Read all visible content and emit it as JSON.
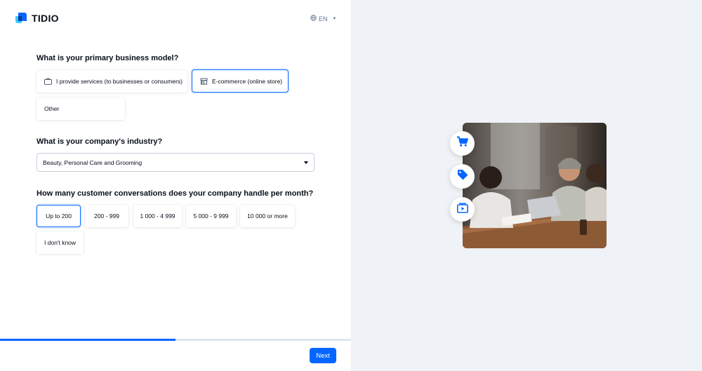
{
  "brand": {
    "name": "TIDIO",
    "logo_color": "#0566ff"
  },
  "language": {
    "icon": "globe-icon",
    "label": "EN"
  },
  "q1": {
    "title": "What is your primary business model?",
    "options": [
      {
        "label": "I provide services (to businesses or consumers)",
        "icon": "briefcase-icon",
        "selected": false
      },
      {
        "label": "E-commerce (online store)",
        "icon": "store-icon",
        "selected": true
      },
      {
        "label": "Other",
        "selected": false
      }
    ]
  },
  "q2": {
    "title": "What is your company's industry?",
    "selected_value": "Beauty, Personal Care and Grooming"
  },
  "q3": {
    "title": "How many customer conversations does your company handle per month?",
    "options": [
      {
        "label": "Up to 200",
        "selected": true
      },
      {
        "label": "200 - 999",
        "selected": false
      },
      {
        "label": "1 000 - 4 999",
        "selected": false
      },
      {
        "label": "5 000 - 9 999",
        "selected": false
      },
      {
        "label": "10 000 or more",
        "selected": false
      },
      {
        "label": "I don't know",
        "selected": false
      }
    ]
  },
  "progress": {
    "fraction": 0.5
  },
  "footer": {
    "next_label": "Next"
  },
  "illustration": {
    "badges": [
      "shopping-cart-icon",
      "price-tag-icon",
      "video-play-icon"
    ],
    "accent": "#0566ff"
  }
}
